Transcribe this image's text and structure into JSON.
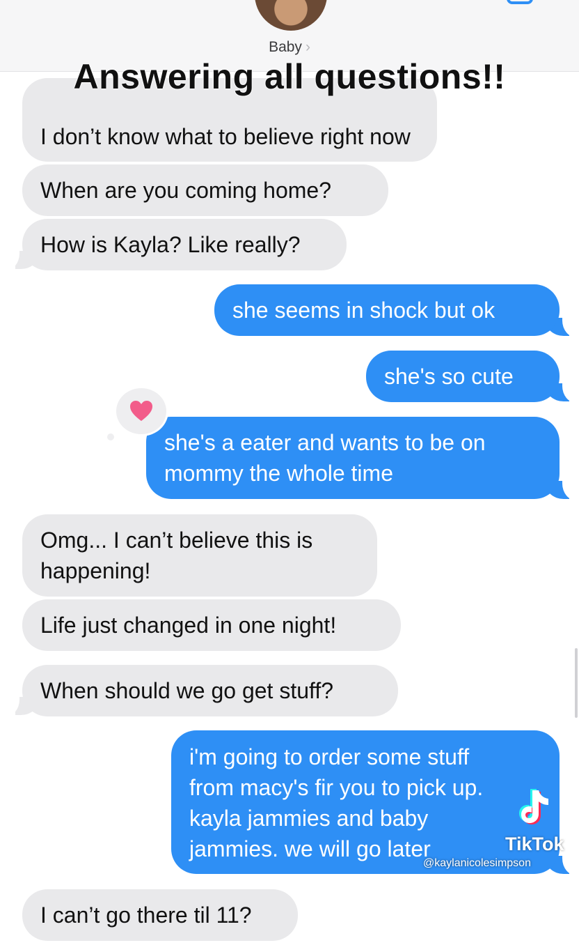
{
  "header": {
    "contact_name": "Baby",
    "chevron": "›",
    "back_icon": "chevron-left-icon",
    "video_icon": "video-camera-icon"
  },
  "overlay_title": "Answering all questions!!",
  "messages": [
    {
      "direction": "incoming",
      "text": "I don’t know what to believe right now"
    },
    {
      "direction": "incoming",
      "text": "When are you coming home?"
    },
    {
      "direction": "incoming",
      "text": "How is Kayla? Like really?"
    },
    {
      "direction": "outgoing",
      "text": "she seems in shock but ok"
    },
    {
      "direction": "outgoing",
      "text": "she's so cute"
    },
    {
      "direction": "outgoing",
      "text": "she's a eater and wants to be on mommy the whole time",
      "reaction": "heart-icon"
    },
    {
      "direction": "incoming",
      "text": "Omg... I can’t believe this is happening!"
    },
    {
      "direction": "incoming",
      "text": "Life just changed in one night!"
    },
    {
      "direction": "incoming",
      "text": "When should we go get stuff?"
    },
    {
      "direction": "outgoing",
      "text": "i'm going to order some stuff from macy's fir you to pick up. kayla jammies and baby jammies. we will go later"
    },
    {
      "direction": "incoming",
      "text": "I can’t go there til 11?"
    }
  ],
  "colors": {
    "incoming_bubble": "#e9e9eb",
    "outgoing_bubble": "#2e8ff5",
    "reaction_heart": "#f25c8a"
  },
  "watermark": {
    "brand": "TikTok",
    "username": "@kaylanicolesimpson"
  }
}
